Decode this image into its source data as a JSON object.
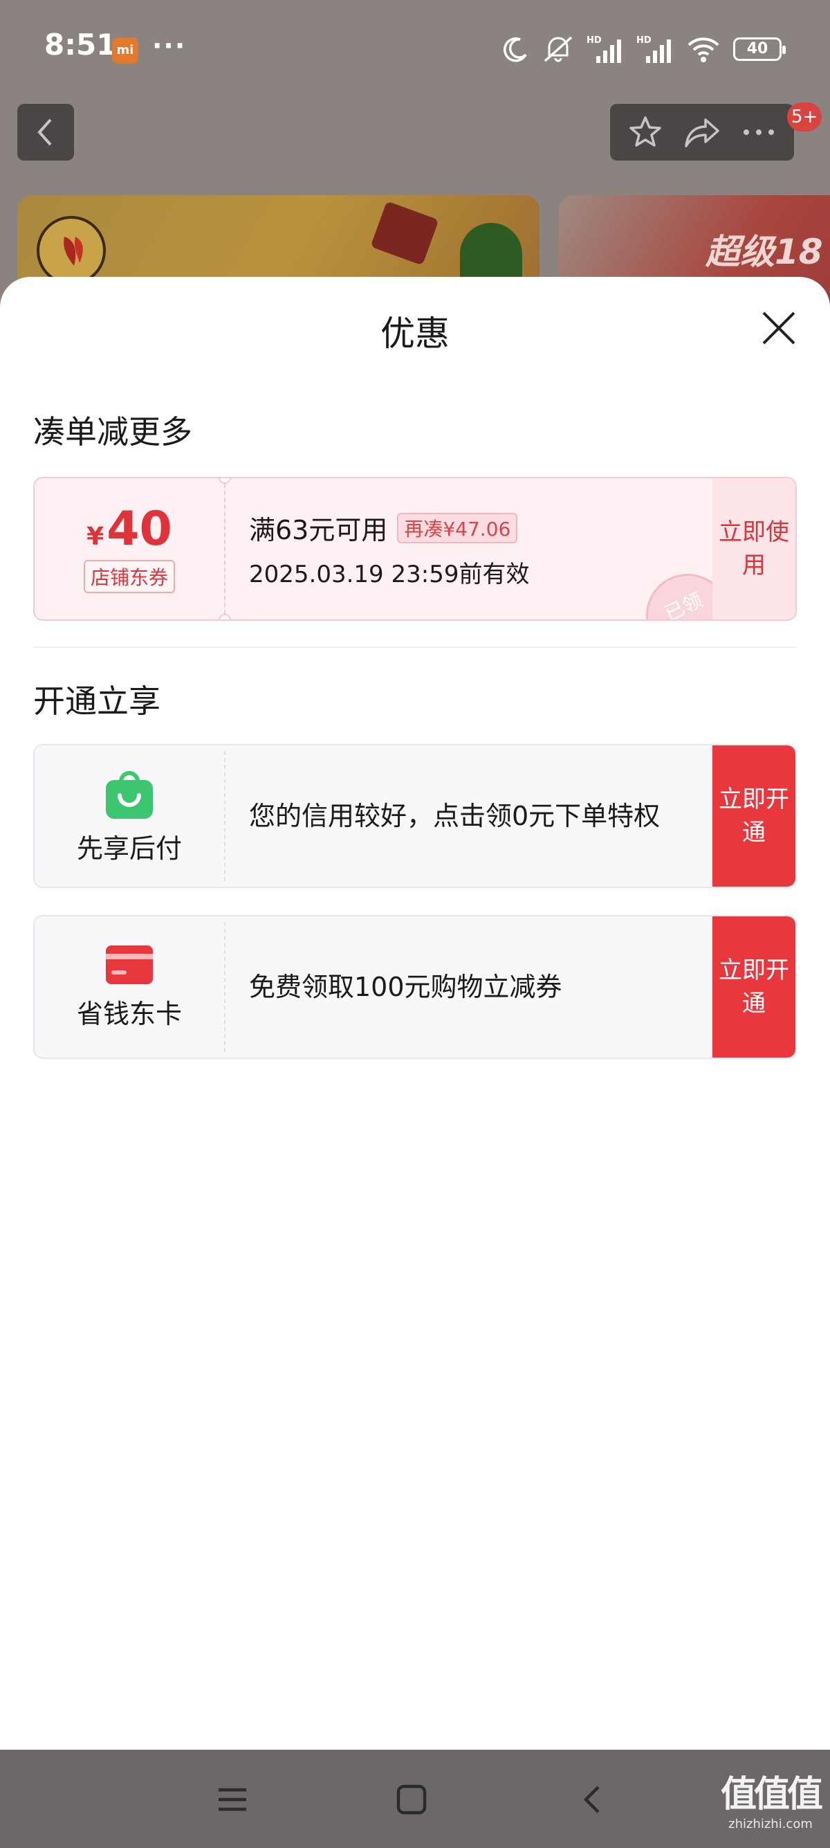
{
  "status_bar": {
    "time": "8:51",
    "carrier_badge": "mi",
    "more": "···",
    "battery": "40"
  },
  "header": {
    "cart_badge": "5+"
  },
  "banner": {
    "right_text": "超级18"
  },
  "sheet": {
    "title": "优惠"
  },
  "section_more": {
    "title": "凑单减更多"
  },
  "coupon": {
    "currency": "¥",
    "amount": "40",
    "tag": "店铺东券",
    "condition": "满63元可用",
    "extra": "再凑¥47.06",
    "validity": "2025.03.19 23:59前有效",
    "action": "立即使用",
    "stamp": "已领"
  },
  "section_open": {
    "title": "开通立享"
  },
  "bnpl": {
    "label": "先享后付",
    "text": "您的信用较好，点击领0元下单特权",
    "action": "立即开通"
  },
  "save_card": {
    "label": "省钱东卡",
    "text": "免费领取100元购物立减券",
    "action": "立即开通"
  },
  "watermark": {
    "big": "值值值",
    "small": "zhizhizhi.com"
  },
  "colors": {
    "accent_red": "#e8373d",
    "coupon_bg": "#fdf1f3",
    "bnpl_green": "#3bc66f"
  }
}
